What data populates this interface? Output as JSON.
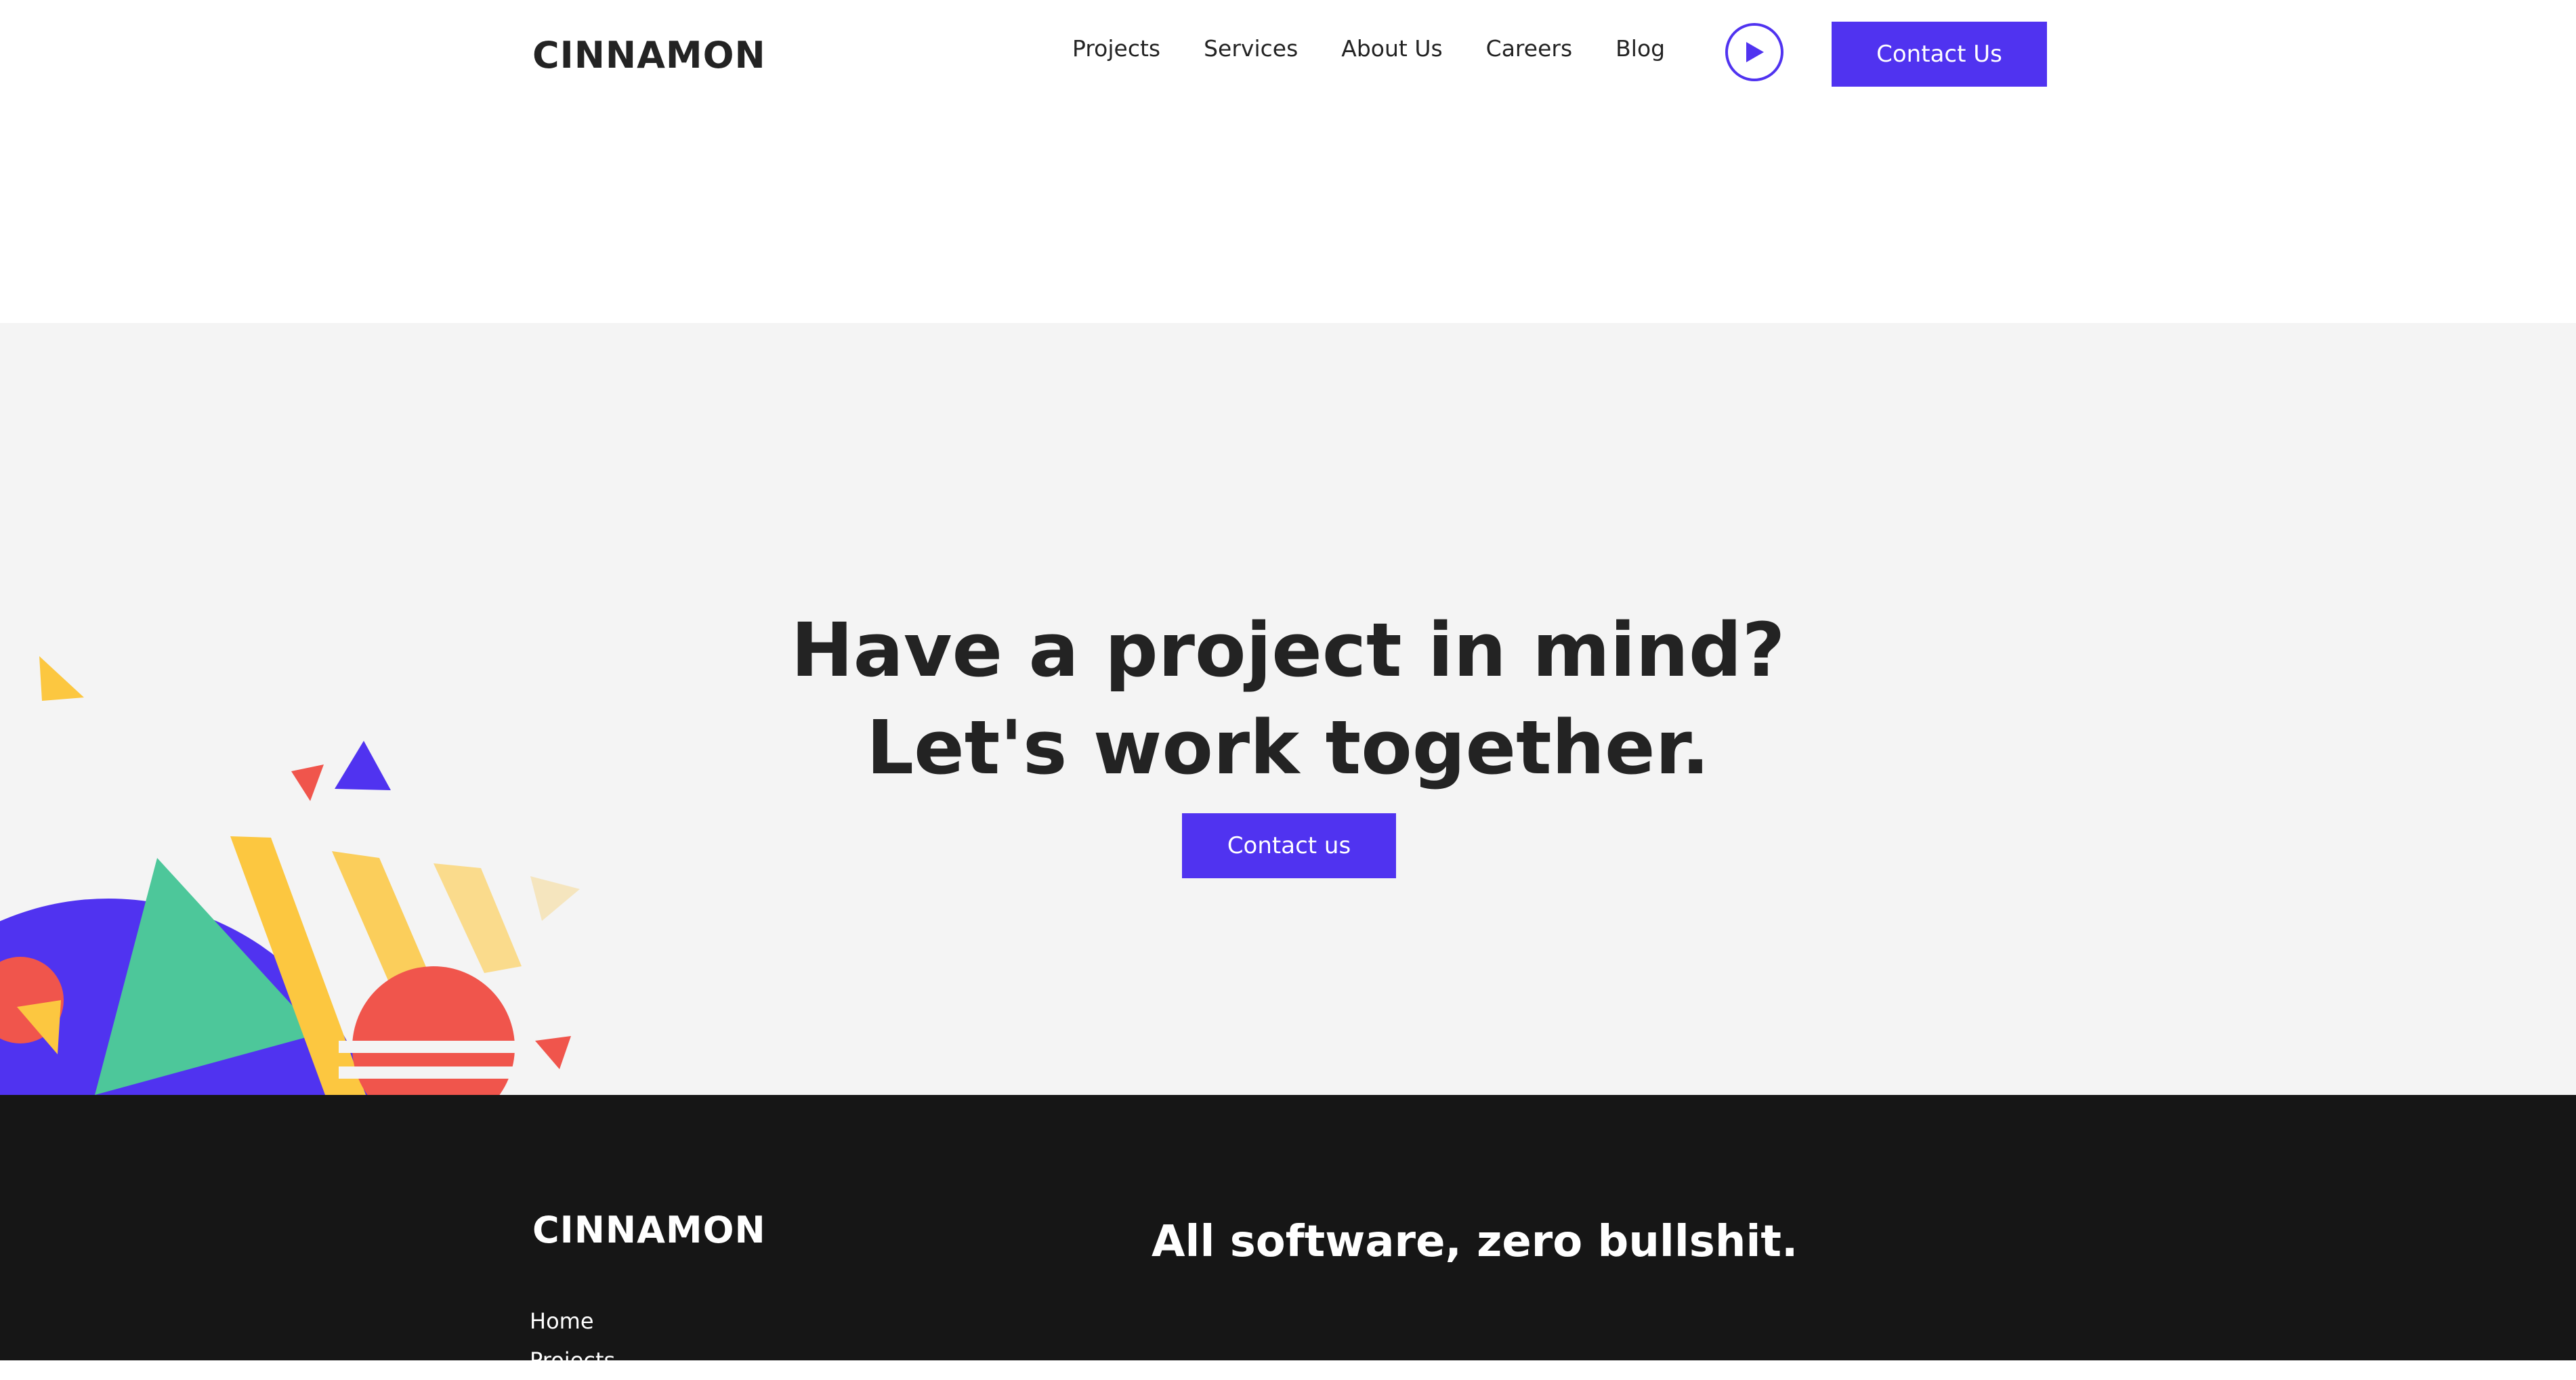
{
  "header": {
    "logo": "CINNAMON",
    "nav": [
      "Projects",
      "Services",
      "About Us",
      "Careers",
      "Blog"
    ],
    "contact_label": "Contact Us"
  },
  "cta": {
    "title_line1": "Have a project in mind?",
    "title_line2": "Let's work together.",
    "button_label": "Contact us"
  },
  "footer": {
    "logo": "CINNAMON",
    "tagline": "All software, zero bullshit.",
    "links": [
      "Home",
      "Projects"
    ]
  },
  "colors": {
    "accent": "#5033f0",
    "footer_bg": "#161616",
    "section_bg": "#f4f4f4",
    "yellow": "#fcc740",
    "green": "#4dc79a",
    "red": "#f0554c"
  },
  "icons": {
    "play": "play-icon"
  }
}
